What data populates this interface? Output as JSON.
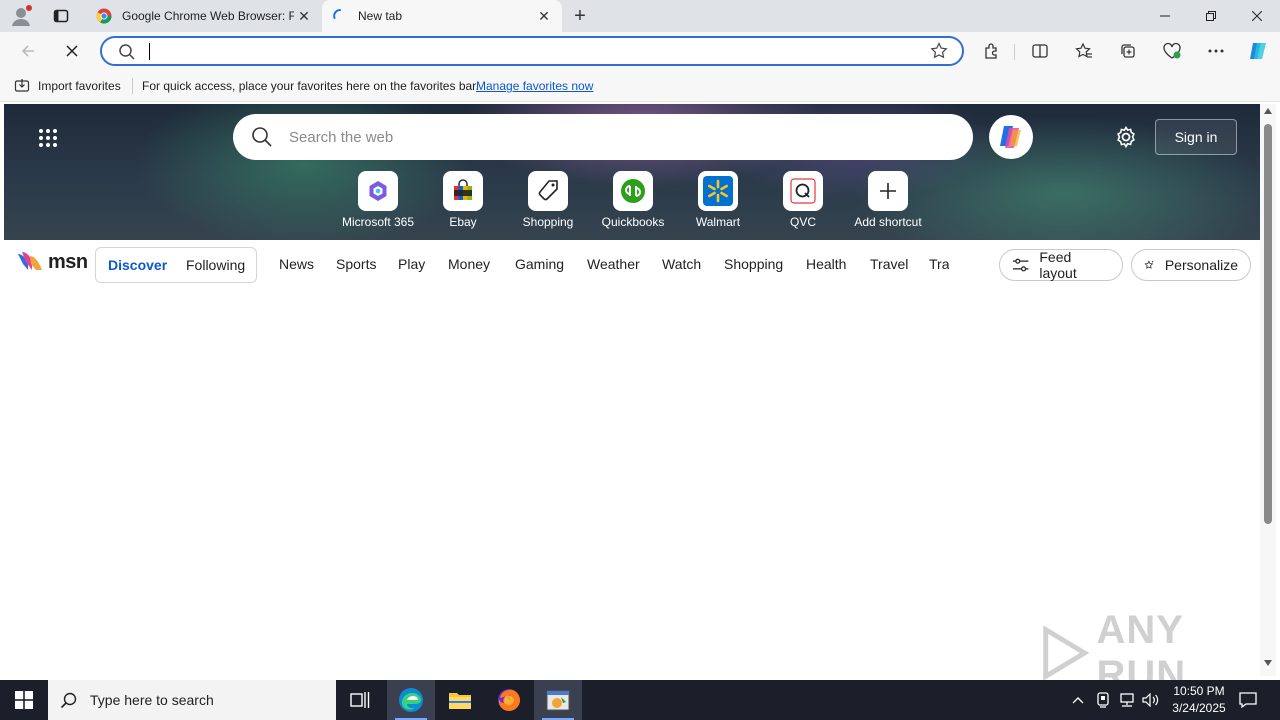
{
  "browser": {
    "tabs": [
      {
        "title": "Google Chrome Web Browser: Fi",
        "active": false
      },
      {
        "title": "New tab",
        "active": true
      }
    ],
    "new_tab_symbol": "+",
    "address_value": "",
    "accent_color": "#2f6fd6"
  },
  "favorites_bar": {
    "import_label": "Import favorites",
    "hint_text": "For quick access, place your favorites here on the favorites bar.",
    "manage_link": "Manage favorites now"
  },
  "newtab": {
    "search_placeholder": "Search the web",
    "sign_in_label": "Sign in",
    "shortcuts": [
      {
        "label": "Microsoft 365",
        "icon": "microsoft-365-icon"
      },
      {
        "label": "Ebay",
        "icon": "ebay-icon"
      },
      {
        "label": "Shopping",
        "icon": "shopping-tag-icon"
      },
      {
        "label": "Quickbooks",
        "icon": "quickbooks-icon"
      },
      {
        "label": "Walmart",
        "icon": "walmart-icon"
      },
      {
        "label": "QVC",
        "icon": "qvc-icon"
      },
      {
        "label": "Add shortcut",
        "icon": "plus-icon"
      }
    ]
  },
  "msn": {
    "logo_text": "msn",
    "feed_tabs": {
      "discover": "Discover",
      "following": "Following"
    },
    "nav_links": [
      "News",
      "Sports",
      "Play",
      "Money",
      "Gaming",
      "Weather",
      "Watch",
      "Shopping",
      "Health",
      "Travel",
      "Tra"
    ],
    "feed_layout_label": "Feed layout",
    "personalize_label": "Personalize"
  },
  "watermark": "ANY RUN",
  "taskbar": {
    "search_placeholder": "Type here to search",
    "time": "10:50 PM",
    "date": "3/24/2025"
  }
}
